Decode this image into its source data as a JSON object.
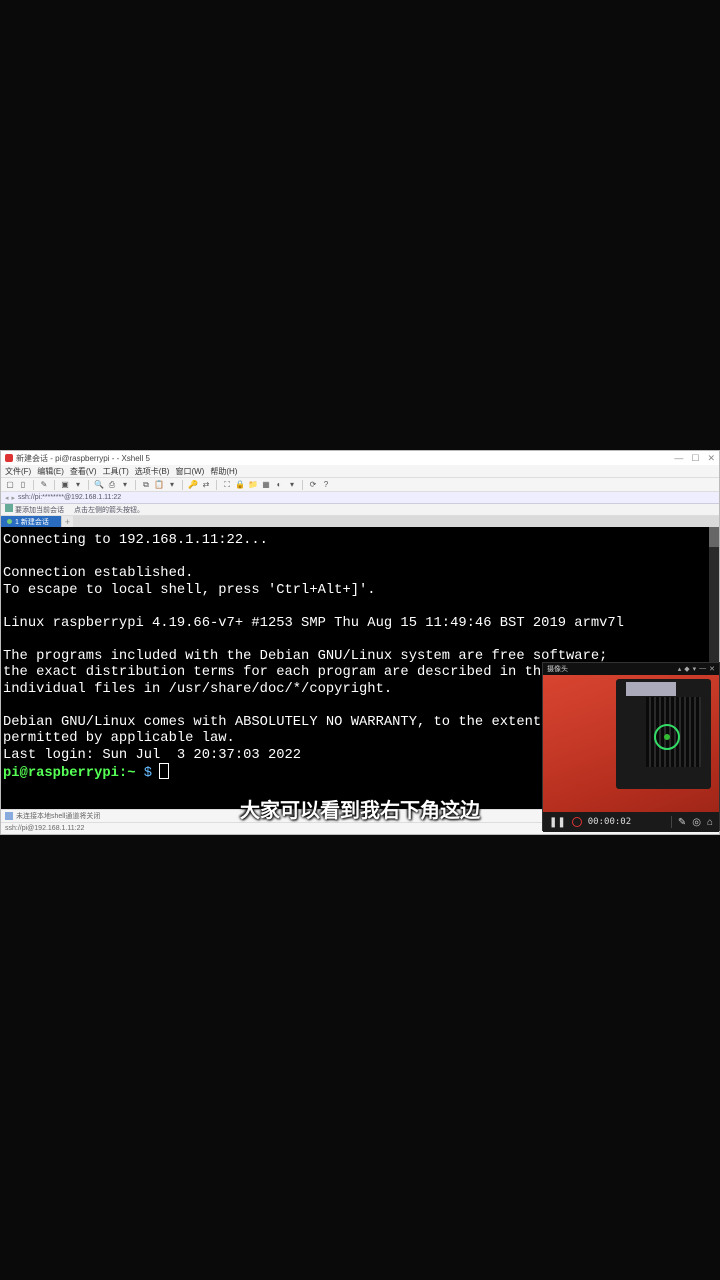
{
  "window": {
    "title": "新建会话 - pi@raspberrypi - - Xshell 5"
  },
  "menu": {
    "file": "文件(F)",
    "edit": "编辑(E)",
    "view": "查看(V)",
    "tools": "工具(T)",
    "tab": "选项卡(B)",
    "window": "窗口(W)",
    "help": "帮助(H)"
  },
  "addressbar": "ssh://pi:********@192.168.1.11:22",
  "quickbar": {
    "item1": "要添加当前会话",
    "item2": "点击左侧的箭头按钮。"
  },
  "tab": {
    "label": "1 新建会话"
  },
  "terminal": {
    "l1": "Connecting to 192.168.1.11:22...",
    "l2": "",
    "l3": "Connection established.",
    "l4": "To escape to local shell, press 'Ctrl+Alt+]'.",
    "l5": "",
    "l6": "Linux raspberrypi 4.19.66-v7+ #1253 SMP Thu Aug 15 11:49:46 BST 2019 armv7l",
    "l7": "",
    "l8": "The programs included with the Debian GNU/Linux system are free software;",
    "l9": "the exact distribution terms for each program are described in the",
    "l10": "individual files in /usr/share/doc/*/copyright.",
    "l11": "",
    "l12": "Debian GNU/Linux comes with ABSOLUTELY NO WARRANTY, to the extent",
    "l13": "permitted by applicable law.",
    "l14": "Last login: Sun Jul  3 20:37:03 2022",
    "prompt_user": "pi@raspberrypi",
    "prompt_path": ":~",
    "prompt_sym": " $ "
  },
  "status1": "未连接本地shell通道将关闭",
  "status2": "ssh://pi@192.168.1.11:22",
  "camera": {
    "title": "摄像头",
    "time": "00:00:02"
  },
  "subtitle": "大家可以看到我右下角这边"
}
